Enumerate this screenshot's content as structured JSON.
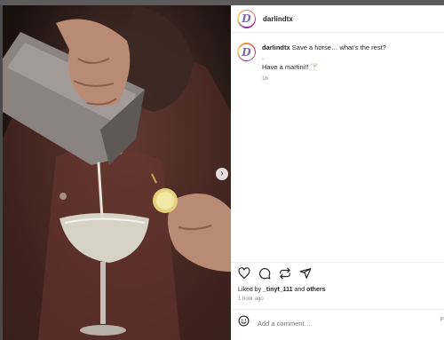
{
  "post": {
    "username": "darlindtx",
    "avatar_letter": "D"
  },
  "caption": {
    "username": "darlindtx",
    "line1": "Save a horse… what's the rest?",
    "line2": ".",
    "line3": "Have a martini!! 🍸",
    "time": "1h"
  },
  "actions": {
    "like_icon": "heart-icon",
    "comment_icon": "comment-icon",
    "share_icon": "repost-icon",
    "send_icon": "send-icon"
  },
  "likes": {
    "prefix": "Liked by ",
    "user": "_tinyt_111",
    "middle": " and ",
    "others": "others"
  },
  "timestamp": "1 hour ago",
  "comment_box": {
    "placeholder": "Add a comment…",
    "post_label": "P"
  },
  "photo": {
    "next_label": "›"
  },
  "colors": {
    "accent": "#0095f6",
    "text": "#262626",
    "muted": "#8e8e8e"
  }
}
